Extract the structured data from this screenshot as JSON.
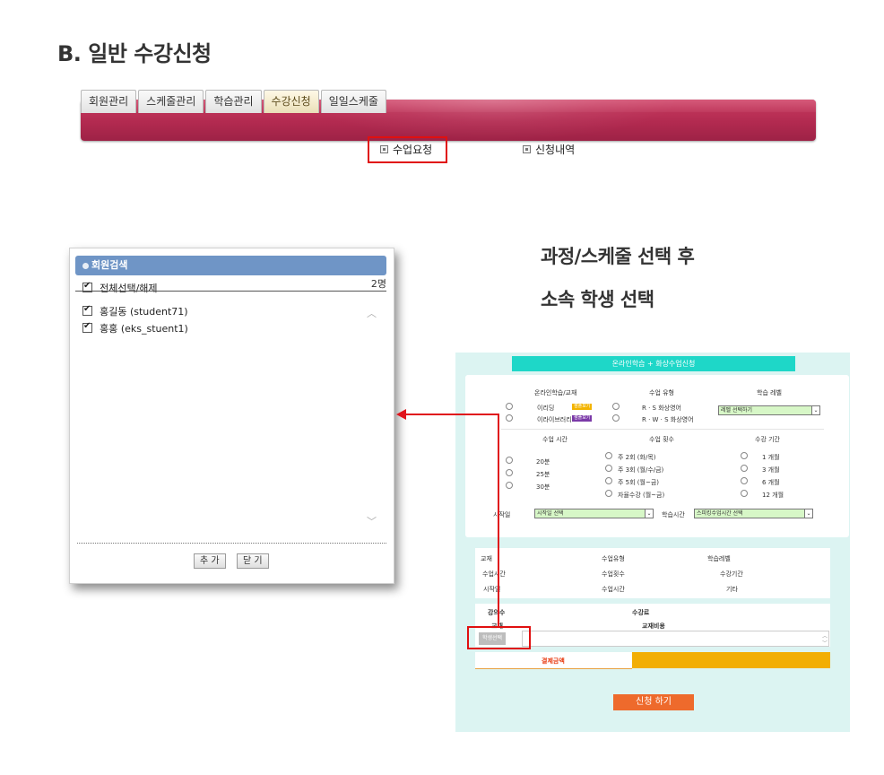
{
  "heading": "B. 일반 수강신청",
  "tabs": [
    "회원관리",
    "스케줄관리",
    "학습관리",
    "수강신청",
    "일일스케줄"
  ],
  "active_tab": 3,
  "subnav": {
    "item1": "수업요청",
    "item2": "신청내역"
  },
  "popup": {
    "title": "회원검색",
    "select_all": "전체선택/해제",
    "count": "2명",
    "members": [
      "홍길동 (student71)",
      "홍홍 (eks_stuent1)"
    ],
    "add_button": "추 가",
    "close_button": "닫 기"
  },
  "caption": {
    "line1": "과정/스케줄 선택 후",
    "line2": "소속 학생 선택"
  },
  "form": {
    "title": "온라인학습 + 화상수업신청",
    "col1_header": "온라인학습/교재",
    "col2_header": "수업 유형",
    "col3_header": "학습 레벨",
    "opt_reading": "이리딩",
    "opt_library": "이라이브러리",
    "badge_reading": "샘플보기",
    "badge_library": "샘플보기",
    "type1": "R · S 화상영어",
    "type2": "R · W · S 화상영어",
    "level_select": "레벨 선택하기",
    "time_header": "수업 시간",
    "freq_header": "수업 횟수",
    "period_header": "수강 기간",
    "times": [
      "20분",
      "25분",
      "30분"
    ],
    "freqs": [
      "주 2회 (화/목)",
      "주 3회 (월/수/금)",
      "주 5회 (월~금)",
      "자율수강 (월~금)"
    ],
    "periods": [
      "1 개월",
      "3 개월",
      "6 개월",
      "12 개월"
    ],
    "start_label": "시작일",
    "start_select": "시작일 선택",
    "study_time_label": "학습시간",
    "study_time_select": "스피킹수업시간 선택",
    "sum_row1": [
      "교재",
      "수업유형",
      "학습레벨"
    ],
    "sum_row2": [
      "수업시간",
      "수업횟수",
      "수강기간"
    ],
    "sum_row3": [
      "시작일",
      "수업시간",
      "기타"
    ],
    "fee_label1": "강의수",
    "fee_label2": "수강료",
    "fee_label3": "교재",
    "fee_label4": "교재비용",
    "student_select_button": "학생선택",
    "pay_label": "결제금액",
    "apply_button": "신청 하기"
  }
}
